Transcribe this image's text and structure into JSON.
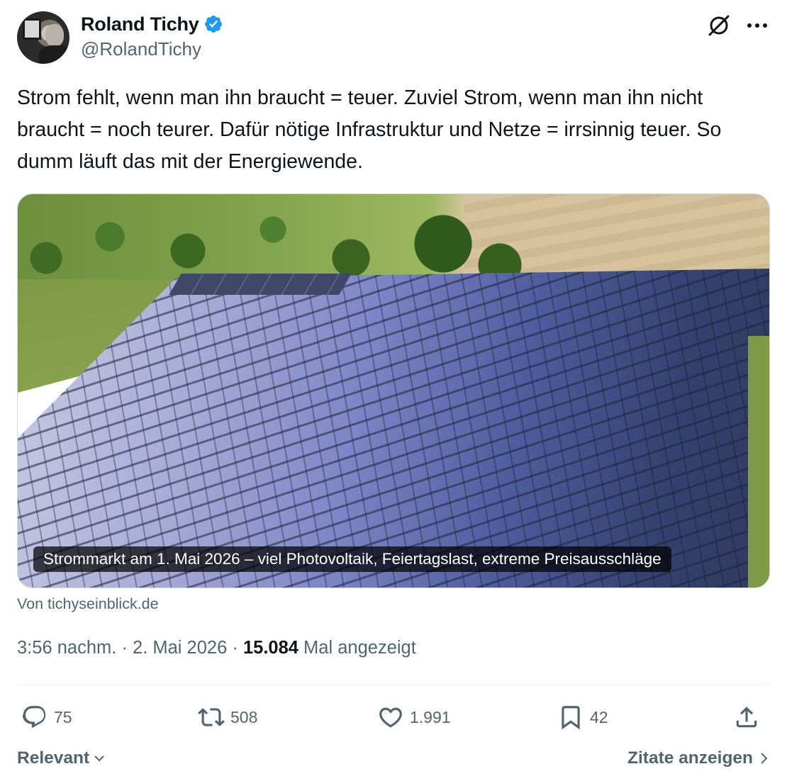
{
  "author": {
    "display_name": "Roland Tichy",
    "handle": "@RolandTichy",
    "verified": true,
    "badge_color": "#1d9bf0"
  },
  "top_icons": [
    "grok-icon",
    "more-icon"
  ],
  "tweet": {
    "text": "Strom fehlt, wenn man ihn braucht = teuer. Zuviel Strom, wenn man ihn nicht braucht = noch teurer. Dafür nötige Infrastruktur und Netze = irrsinnig teuer. So dumm läuft das mit der Energiewende."
  },
  "link_card": {
    "caption": "Strommarkt am 1. Mai 2026 – viel Photovoltaik, Feiertagslast, extreme Preisausschläge",
    "source": "Von tichyseinblick.de"
  },
  "meta": {
    "time": "3:56 nachm.",
    "separator": " · ",
    "date": "2. Mai 2026",
    "views_count": "15.084",
    "views_label": "Mal angezeigt"
  },
  "actions": {
    "replies": "75",
    "retweets": "508",
    "likes": "1.991",
    "bookmarks": "42"
  },
  "footer": {
    "sort_label": "Relevant",
    "quotes_label": "Zitate anzeigen"
  },
  "colors": {
    "text_primary": "#0f1419",
    "text_secondary": "#536471",
    "verified_blue": "#1d9bf0"
  }
}
